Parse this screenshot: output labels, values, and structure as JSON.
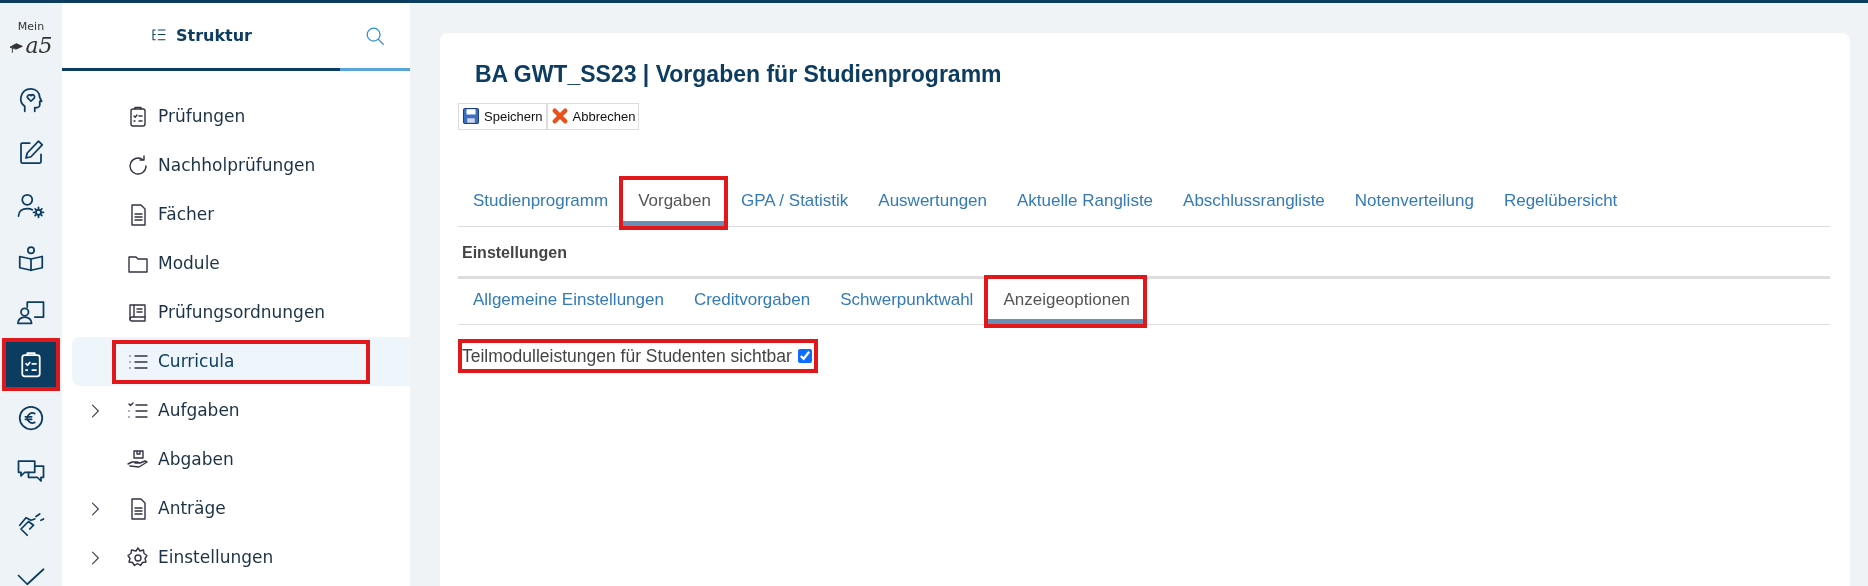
{
  "rail": {
    "logo_label": "Mein",
    "logo_text": "a5",
    "items": [
      {
        "selected": false,
        "highlighted": false
      },
      {
        "selected": false,
        "highlighted": false
      },
      {
        "selected": false,
        "highlighted": false
      },
      {
        "selected": false,
        "highlighted": false
      },
      {
        "selected": false,
        "highlighted": false
      },
      {
        "selected": true,
        "highlighted": true
      },
      {
        "selected": false,
        "highlighted": false
      },
      {
        "selected": false,
        "highlighted": false
      },
      {
        "selected": false,
        "highlighted": false
      },
      {
        "selected": false,
        "highlighted": false
      }
    ]
  },
  "sidebar": {
    "title": "Struktur",
    "items": [
      {
        "label": "Prüfungen",
        "expandable": false,
        "selected": false,
        "highlighted": false
      },
      {
        "label": "Nachholprüfungen",
        "expandable": false,
        "selected": false,
        "highlighted": false
      },
      {
        "label": "Fächer",
        "expandable": false,
        "selected": false,
        "highlighted": false
      },
      {
        "label": "Module",
        "expandable": false,
        "selected": false,
        "highlighted": false
      },
      {
        "label": "Prüfungsordnungen",
        "expandable": false,
        "selected": false,
        "highlighted": false
      },
      {
        "label": "Curricula",
        "expandable": false,
        "selected": true,
        "highlighted": true
      },
      {
        "label": "Aufgaben",
        "expandable": true,
        "selected": false,
        "highlighted": false
      },
      {
        "label": "Abgaben",
        "expandable": false,
        "selected": false,
        "highlighted": false
      },
      {
        "label": "Anträge",
        "expandable": true,
        "selected": false,
        "highlighted": false
      },
      {
        "label": "Einstellungen",
        "expandable": true,
        "selected": false,
        "highlighted": false
      }
    ]
  },
  "main": {
    "title": "BA GWT_SS23 | Vorgaben für Studienprogramm",
    "toolbar": [
      {
        "label": "Speichern",
        "kind": "save"
      },
      {
        "label": "Abbrechen",
        "kind": "cancel"
      }
    ],
    "tabs": [
      {
        "label": "Studienprogramm",
        "selected": false,
        "highlighted": false
      },
      {
        "label": "Vorgaben",
        "selected": true,
        "highlighted": true
      },
      {
        "label": "GPA / Statistik",
        "selected": false,
        "highlighted": false
      },
      {
        "label": "Auswertungen",
        "selected": false,
        "highlighted": false
      },
      {
        "label": "Aktuelle Rangliste",
        "selected": false,
        "highlighted": false
      },
      {
        "label": "Abschlussrangliste",
        "selected": false,
        "highlighted": false
      },
      {
        "label": "Notenverteilung",
        "selected": false,
        "highlighted": false
      },
      {
        "label": "Regelübersicht",
        "selected": false,
        "highlighted": false
      }
    ],
    "section_title": "Einstellungen",
    "subtabs": [
      {
        "label": "Allgemeine Einstellungen",
        "selected": false,
        "highlighted": false
      },
      {
        "label": "Creditvorgaben",
        "selected": false,
        "highlighted": false
      },
      {
        "label": "Schwerpunktwahl",
        "selected": false,
        "highlighted": false
      },
      {
        "label": "Anzeigeoptionen",
        "selected": true,
        "highlighted": true
      }
    ],
    "option": {
      "label": "Teilmodulleistungen für Studenten sichtbar",
      "checked": true,
      "highlighted": true
    }
  }
}
